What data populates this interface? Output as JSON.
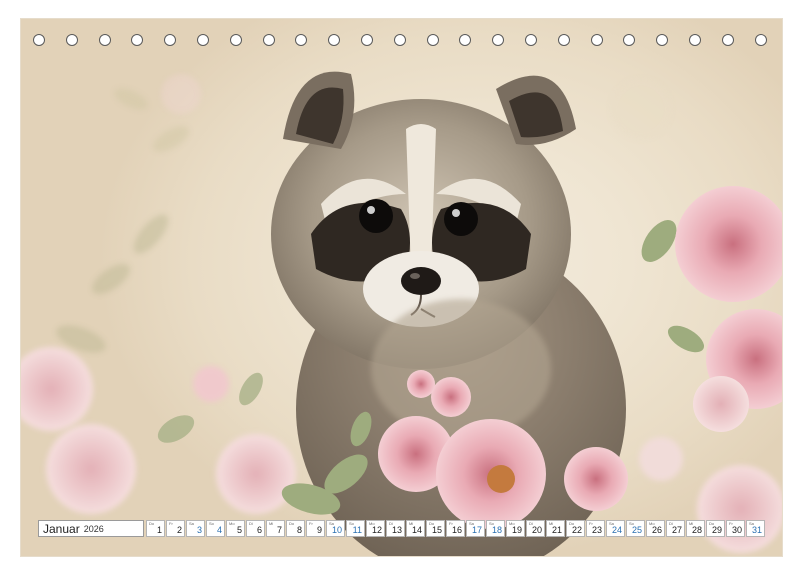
{
  "calendar": {
    "month": "Januar",
    "year": "2026",
    "weekday_labels": [
      "Do",
      "Fr",
      "Sa",
      "So",
      "Mo",
      "Di",
      "Mi",
      "Do",
      "Fr",
      "Sa",
      "So",
      "Mo",
      "Di",
      "Mi",
      "Do",
      "Fr",
      "Sa",
      "So",
      "Mo",
      "Di",
      "Mi",
      "Do",
      "Fr",
      "Sa",
      "So",
      "Mo",
      "Di",
      "Mi",
      "Do",
      "Fr",
      "Sa"
    ],
    "days": [
      "1",
      "2",
      "3",
      "4",
      "5",
      "6",
      "7",
      "8",
      "9",
      "10",
      "11",
      "12",
      "13",
      "14",
      "15",
      "16",
      "17",
      "18",
      "19",
      "20",
      "21",
      "22",
      "23",
      "24",
      "25",
      "26",
      "27",
      "28",
      "29",
      "30",
      "31"
    ],
    "weekend_color": "#2a6fb0"
  },
  "image": {
    "subject": "baby raccoon among pink peonies",
    "accent_pink": "#e8a9b3",
    "leaf_green": "#a7b38a"
  },
  "binding": {
    "hole_count": 23
  }
}
